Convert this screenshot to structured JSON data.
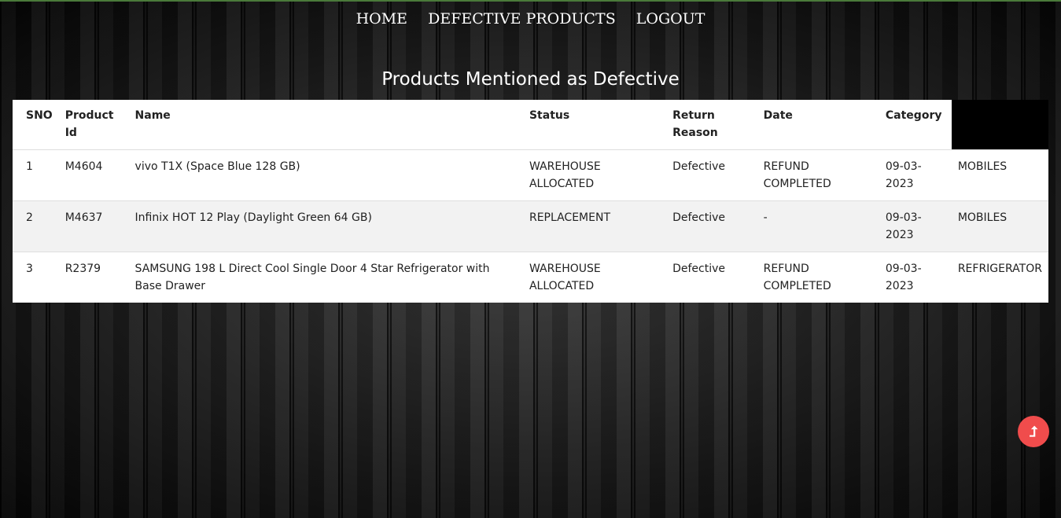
{
  "nav": {
    "items": [
      "HOME",
      "DEFECTIVE PRODUCTS",
      "LOGOUT"
    ]
  },
  "page_title": "Products Mentioned as Defective",
  "table": {
    "headers": [
      "SNO",
      "Product Id",
      "Name",
      "Status",
      "Return Reason",
      "Date",
      "Category"
    ],
    "rows": [
      [
        "1",
        "M4604",
        "vivo T1X (Space Blue 128 GB)",
        "WAREHOUSE ALLOCATED",
        "Defective",
        "REFUND COMPLETED",
        "09-03-2023",
        "MOBILES"
      ],
      [
        "2",
        "M4637",
        "Infinix HOT 12 Play (Daylight Green 64 GB)",
        "REPLACEMENT",
        "Defective",
        "-",
        "09-03-2023",
        "MOBILES"
      ],
      [
        "3",
        "R2379",
        "SAMSUNG 198 L Direct Cool Single Door 4 Star Refrigerator with Base Drawer",
        "WAREHOUSE ALLOCATED",
        "Defective",
        "REFUND COMPLETED",
        "09-03-2023",
        "REFRIGERATOR"
      ]
    ]
  },
  "scroll_top": {
    "icon": "arrow-up-icon",
    "glyph": "⮥",
    "color": "#f04c4c"
  }
}
